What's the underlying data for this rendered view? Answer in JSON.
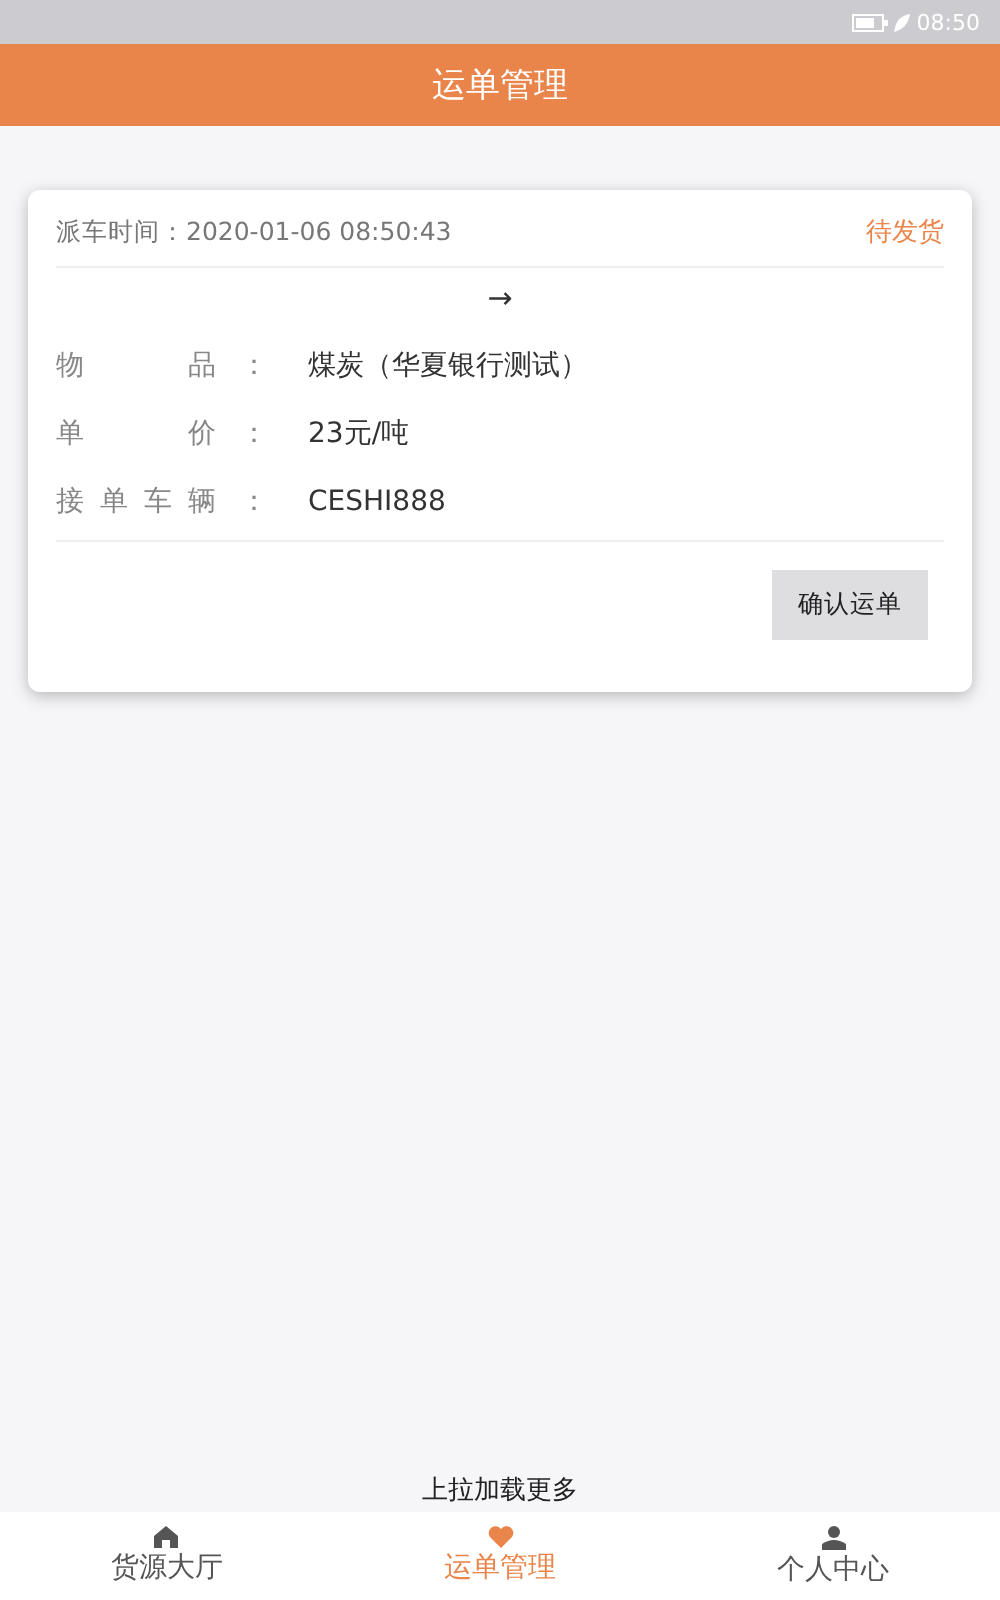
{
  "status_bar": {
    "time": "08:50"
  },
  "header": {
    "title": "运单管理"
  },
  "orders": [
    {
      "dispatch_time": "派车时间：2020-01-06 08:50:43",
      "status": "待发货",
      "route_arrow": "→",
      "fields": [
        {
          "label": [
            "物",
            "品"
          ],
          "colon": "：",
          "value": "煤炭（华夏银行测试）"
        },
        {
          "label": [
            "单",
            "价"
          ],
          "colon": "：",
          "value": "23元/吨"
        },
        {
          "label": [
            "接",
            "单",
            "车",
            "辆"
          ],
          "colon": "：",
          "value": "CESHI888"
        }
      ],
      "action": "确认运单"
    }
  ],
  "load_more": "上拉加载更多",
  "tabs": [
    {
      "label": "货源大厅",
      "selected": false
    },
    {
      "label": "运单管理",
      "selected": true
    },
    {
      "label": "个人中心",
      "selected": false
    }
  ]
}
